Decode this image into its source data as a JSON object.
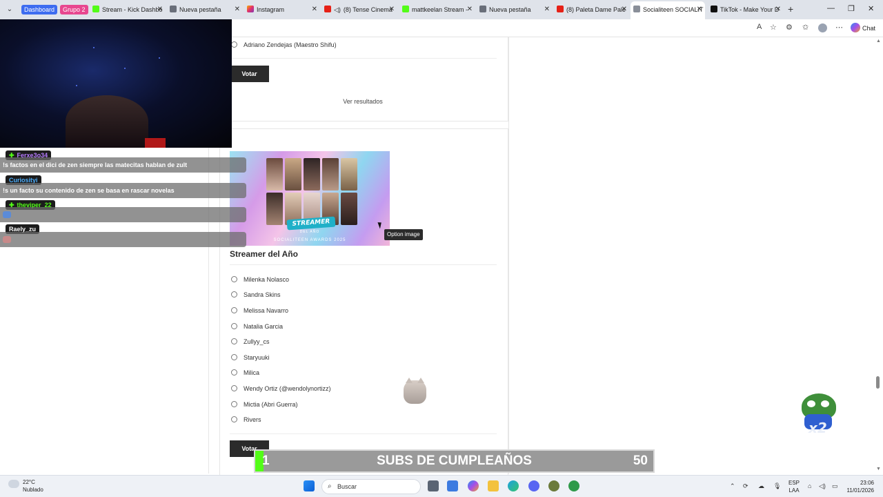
{
  "tabs": {
    "groups": [
      {
        "label": "Dashboard",
        "color": "#3d6cf0"
      },
      {
        "label": "Grupo 2",
        "color": "#e8478f"
      }
    ],
    "items": [
      {
        "label": "Stream - Kick Dashbo",
        "icon": "kick-icon"
      },
      {
        "label": "Nueva pestaña",
        "icon": "page-icon"
      },
      {
        "label": "Instagram",
        "icon": "instagram-icon"
      },
      {
        "label": "(8) Tense Cinema",
        "icon": "youtube-icon"
      },
      {
        "label": "mattkeelan Stream -",
        "icon": "kick-icon"
      },
      {
        "label": "Nueva pestaña",
        "icon": "page-icon"
      },
      {
        "label": "(8) Paleta Dame Pale",
        "icon": "youtube-icon"
      },
      {
        "label": "Socialiteen SOCIALIT",
        "icon": "page-icon",
        "active": true
      },
      {
        "label": "TikTok - Make Your D",
        "icon": "tiktok-icon"
      }
    ]
  },
  "browser": {
    "copilot_label": "Chat"
  },
  "poll1": {
    "last_option": "Adriano Zendejas (Maestro Shifu)",
    "vote_label": "Votar",
    "results_label": "Ver resultados"
  },
  "poll2": {
    "image_tooltip": "Option image",
    "poster_banner": "STREAMER",
    "poster_sub": "DEL AÑO",
    "poster_footer": "SOCIALITEEN AWARDS 2025",
    "title": "Streamer del Año",
    "options": [
      "Milenka Nolasco",
      "Sandra Skins",
      "Melissa Navarro",
      "Natalia Garcia",
      "Zullyy_cs",
      "Staryuuki",
      "Milica",
      "Wendy Ortiz (@wendolynortizz)",
      "Mictia (Abri Guerra)",
      "Rivers"
    ],
    "vote_label": "Votar"
  },
  "chat": {
    "messages": [
      {
        "user": "Ferxe3o34",
        "user_color": "#b77cff",
        "badge": true,
        "text": "!s factos en el dici de zen siempre las matecitas hablan de zult"
      },
      {
        "user": "Curiosityi",
        "user_color": "#4fb0ff",
        "badge": false,
        "text": "!s un facto su contenido de zen se basa en rascar novelas"
      },
      {
        "user": "theviper_22",
        "user_color": "#53fc18",
        "badge": true,
        "text": ""
      },
      {
        "user": "Raely_zu",
        "user_color": "#ffffff",
        "badge": false,
        "text": ""
      }
    ]
  },
  "subs_goal": {
    "current": "1",
    "title": "SUBS DE CUMPLEAÑOS",
    "target": "50",
    "progress": 0.02
  },
  "overlay": {
    "multiplier": "x2"
  },
  "taskbar": {
    "weather_temp": "22°C",
    "weather_desc": "Nublado",
    "search_placeholder": "Buscar",
    "lang_top": "ESP",
    "lang_bottom": "LAA",
    "time": "23:06",
    "date": "11/01/2026"
  }
}
